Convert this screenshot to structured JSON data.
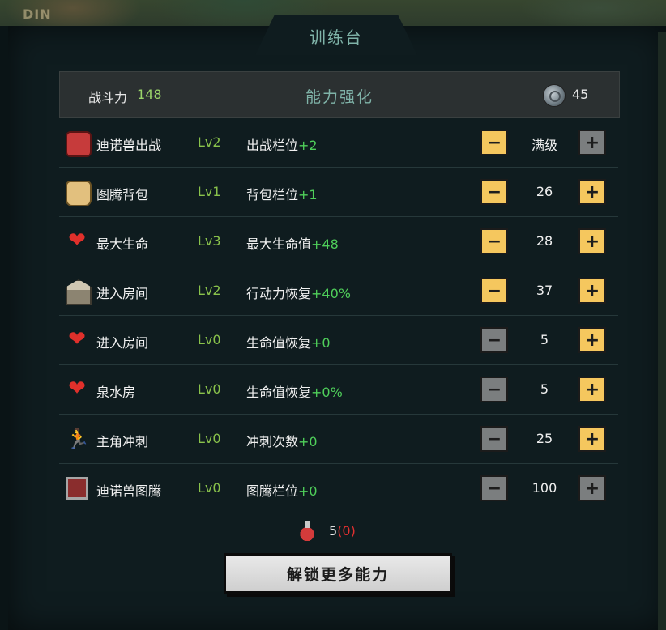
{
  "window": {
    "title": "训练台",
    "corner_logo": "DIN"
  },
  "header": {
    "power_label": "战斗力",
    "power_value": "148",
    "title": "能力强化",
    "coin_icon": "spiral-coin-icon",
    "coin_value": "45"
  },
  "rows": [
    {
      "icon": "dino-battle-icon",
      "name": "迪诺兽出战",
      "level": "Lv2",
      "effect": "出战栏位",
      "bonus": "+2",
      "cost": "满级",
      "minus_enabled": true,
      "plus_enabled": false
    },
    {
      "icon": "bag-icon",
      "name": "图腾背包",
      "level": "Lv1",
      "effect": "背包栏位",
      "bonus": "+1",
      "cost": "26",
      "minus_enabled": true,
      "plus_enabled": true
    },
    {
      "icon": "heart-icon",
      "name": "最大生命",
      "level": "Lv3",
      "effect": "最大生命值",
      "bonus": "+48",
      "cost": "28",
      "minus_enabled": true,
      "plus_enabled": true
    },
    {
      "icon": "room-icon",
      "name": "进入房间",
      "level": "Lv2",
      "effect": "行动力恢复",
      "bonus": "+40%",
      "cost": "37",
      "minus_enabled": true,
      "plus_enabled": true
    },
    {
      "icon": "heart-arrow-icon",
      "name": "进入房间",
      "level": "Lv0",
      "effect": "生命值恢复",
      "bonus": "+0",
      "cost": "5",
      "minus_enabled": false,
      "plus_enabled": true
    },
    {
      "icon": "heart-plus-icon",
      "name": "泉水房",
      "level": "Lv0",
      "effect": "生命值恢复",
      "bonus": "+0%",
      "cost": "5",
      "minus_enabled": false,
      "plus_enabled": true
    },
    {
      "icon": "runner-icon",
      "name": "主角冲刺",
      "level": "Lv0",
      "effect": "冲刺次数",
      "bonus": "+0",
      "cost": "25",
      "minus_enabled": false,
      "plus_enabled": true
    },
    {
      "icon": "totem-icon",
      "name": "迪诺兽图腾",
      "level": "Lv0",
      "effect": "图腾栏位",
      "bonus": "+0",
      "cost": "100",
      "minus_enabled": false,
      "plus_enabled": false
    }
  ],
  "potion": {
    "icon": "potion-icon",
    "count": "5",
    "pending": "(0)"
  },
  "unlock_button": "解锁更多能力",
  "colors": {
    "accent": "#f5c75e",
    "level": "#89c24b",
    "bonus": "#4fcf5a",
    "title": "#7fb3a8"
  }
}
